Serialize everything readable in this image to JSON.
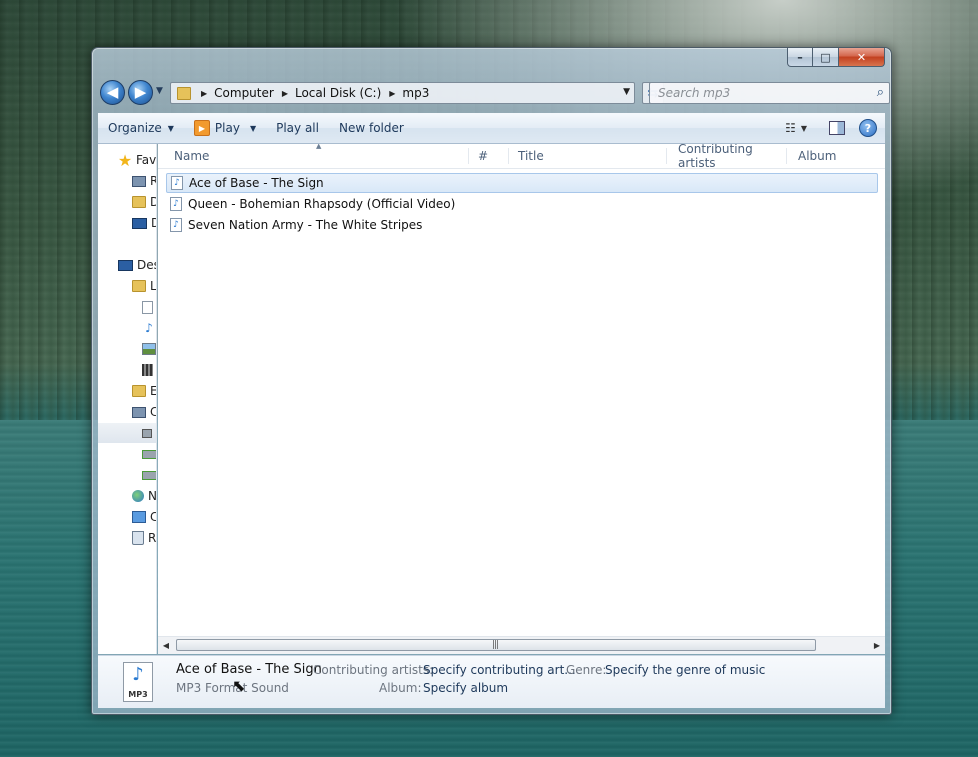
{
  "window": {
    "minimize": "–",
    "maximize": "□",
    "close": "✕"
  },
  "nav": {
    "back": "◀",
    "forward": "▶",
    "breadcrumb": [
      "Computer",
      "Local Disk (C:)",
      "mp3"
    ],
    "search_placeholder": "Search mp3"
  },
  "toolbar": {
    "organize": "Organize",
    "play": "Play",
    "play_all": "Play all",
    "new_folder": "New folder"
  },
  "sidebar": {
    "items": [
      {
        "label": "Fav",
        "icon": "star-icon"
      },
      {
        "label": "R",
        "icon": "recent-places-icon"
      },
      {
        "label": "D",
        "icon": "downloads-folder-icon"
      },
      {
        "label": "D",
        "icon": "desktop-icon"
      },
      {
        "label": "Des",
        "icon": "desktop-icon"
      },
      {
        "label": "L",
        "icon": "libraries-icon"
      },
      {
        "label": "",
        "icon": "documents-icon"
      },
      {
        "label": "",
        "icon": "music-icon"
      },
      {
        "label": "",
        "icon": "pictures-icon"
      },
      {
        "label": "",
        "icon": "videos-icon"
      },
      {
        "label": "E",
        "icon": "user-folder-icon"
      },
      {
        "label": "C",
        "icon": "computer-icon"
      },
      {
        "label": "",
        "icon": "local-disk-icon"
      },
      {
        "label": "",
        "icon": "network-drive-icon"
      },
      {
        "label": "",
        "icon": "network-drive-icon"
      },
      {
        "label": "N",
        "icon": "network-icon"
      },
      {
        "label": "C",
        "icon": "control-panel-icon"
      },
      {
        "label": "R",
        "icon": "recycle-bin-icon"
      }
    ]
  },
  "columns": [
    "Name",
    "#",
    "Title",
    "Contributing artists",
    "Album"
  ],
  "files": [
    {
      "name": "Ace of Base - The Sign",
      "selected": true
    },
    {
      "name": "Queen - Bohemian Rhapsody (Official Video)",
      "selected": false
    },
    {
      "name": "Seven Nation Army - The White Stripes",
      "selected": false
    }
  ],
  "details": {
    "name": "Ace of Base - The Sign",
    "type": "MP3 Format Sound",
    "icon_label": "MP3",
    "contributing_artists_label": "Contributing artists:",
    "contributing_artists_value": "Specify contributing art...",
    "genre_label": "Genre:",
    "genre_value": "Specify the genre of music",
    "album_label": "Album:",
    "album_value": "Specify album"
  },
  "colors": {
    "accent": "#1e395b",
    "selection": "#d9e8f8"
  }
}
